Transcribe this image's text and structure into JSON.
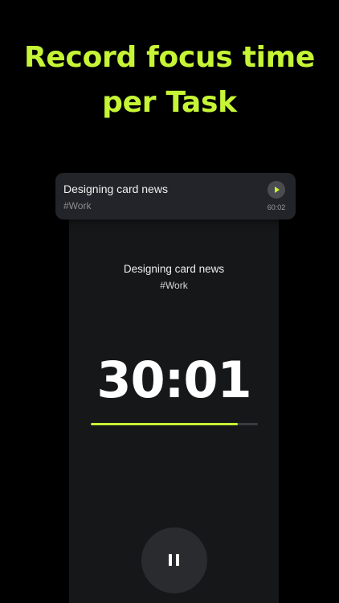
{
  "headline": {
    "line1": "Record focus time",
    "line2": "per Task"
  },
  "task_card": {
    "title": "Designing card news",
    "tag": "#Work",
    "duration": "60:02",
    "play_icon": "play-icon"
  },
  "focus": {
    "title": "Designing card news",
    "tag": "#Work",
    "timer": "30:01",
    "progress_fraction": 0.88
  },
  "controls": {
    "pause_icon": "pause-icon"
  },
  "colors": {
    "accent": "#c6f536",
    "background": "#000000",
    "screen": "#161719",
    "card": "#232429"
  }
}
